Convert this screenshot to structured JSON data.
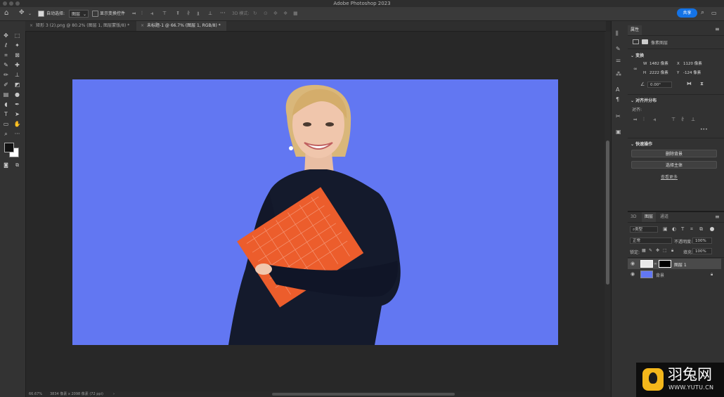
{
  "app": {
    "title": "Adobe Photoshop 2023"
  },
  "options_bar": {
    "auto_select_label": "自动选择:",
    "auto_select_value": "图层",
    "show_transform_label": "显示变换控件",
    "mode_3d_label": "3D 模式:",
    "share_label": "共享"
  },
  "tabs": [
    {
      "label": "矩形 3 (2).png @ 80.2% (图层 1, 图层蒙版/8) *",
      "active": false
    },
    {
      "label": "未标题-1 @ 66.7% (图层 1, RGB/8) *",
      "active": true
    }
  ],
  "canvas": {
    "background_color": "#6277f2"
  },
  "status_bar": {
    "zoom": "66.67%",
    "doc_info": "3834 像素 x 2098 像素 (72 ppi)"
  },
  "properties_panel": {
    "tab_label": "属性",
    "pixel_layer_label": "像素图层",
    "transform": {
      "heading": "变换",
      "w_label": "W",
      "w_value": "1482 像素",
      "x_label": "X",
      "x_value": "1120 像素",
      "h_label": "H",
      "h_value": "2222 像素",
      "y_label": "Y",
      "y_value": "-124 像素",
      "angle_value": "0.00°"
    },
    "align": {
      "heading": "对齐并分布",
      "align_label": "对齐:",
      "more": "•••"
    },
    "quick_actions": {
      "heading": "快速操作",
      "remove_bg": "删除背景",
      "select_subject": "选择主体",
      "see_more": "查看更多"
    }
  },
  "layers_panel": {
    "tabs": [
      "3D",
      "图层",
      "通道"
    ],
    "active_tab": "图层",
    "filter_kind": "类型",
    "blend_mode": "正常",
    "opacity_label": "不透明度:",
    "opacity_value": "100%",
    "lock_label": "锁定:",
    "fill_label": "填充:",
    "fill_value": "100%",
    "layers": [
      {
        "name": "图层 1",
        "selected": true
      },
      {
        "name": "背景",
        "selected": false
      }
    ]
  },
  "watermark": {
    "brand_cn": "羽兔网",
    "url": "WWW.YUTU.CN",
    "logo_color": "#f4b71b"
  }
}
